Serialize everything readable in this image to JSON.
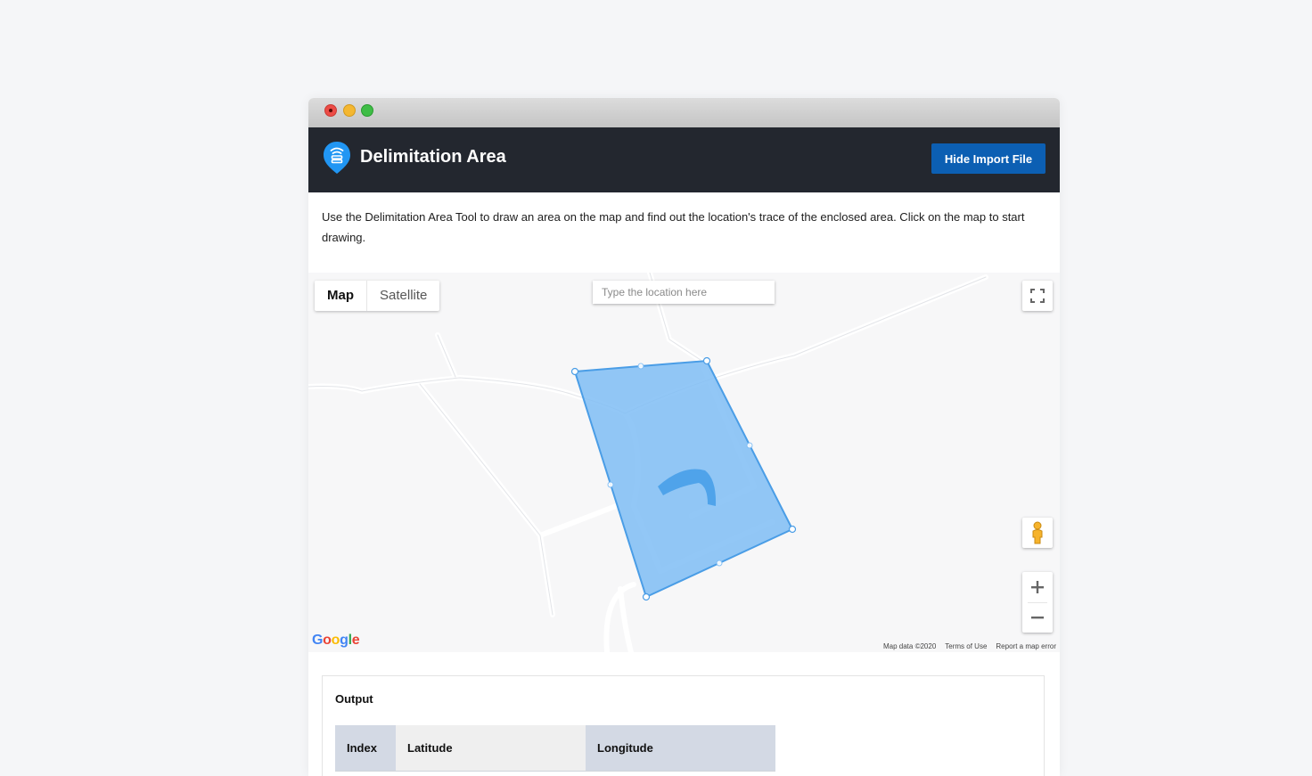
{
  "window": {
    "controls": [
      "close-icon",
      "minimize-icon",
      "maximize-icon"
    ]
  },
  "header": {
    "title": "Delimitation Area",
    "logo_icon": "location-pin-icon",
    "hide_import_button": "Hide Import File",
    "background": "#23272f",
    "button_color": "#0c5fb3"
  },
  "description": "Use the Delimitation Area Tool to draw an area on the map and find out the location's trace of the enclosed area. Click on the map to start drawing.",
  "map": {
    "type_control": {
      "map_label": "Map",
      "satellite_label": "Satellite",
      "selected": "Map"
    },
    "search": {
      "placeholder": "Type the location here",
      "value": ""
    },
    "fullscreen_icon": "fullscreen-icon",
    "pegman_icon": "street-view-pegman-icon",
    "zoom_in_label": "+",
    "zoom_out_label": "−",
    "google_logo": "Google",
    "attribution": {
      "map_data": "Map data ©2020",
      "terms": "Terms of Use",
      "report": "Report a map error"
    },
    "polygon_color": "#7fbdf5"
  },
  "output": {
    "title": "Output",
    "columns": [
      "Index",
      "Latitude",
      "Longitude"
    ]
  }
}
